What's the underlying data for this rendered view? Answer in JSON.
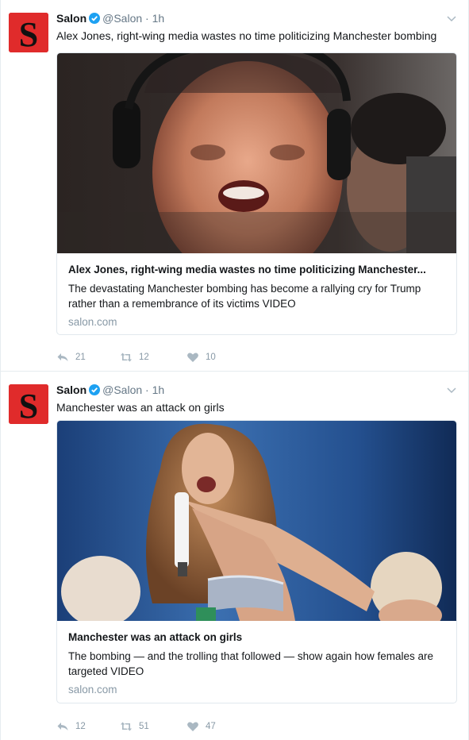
{
  "tweets": [
    {
      "author_name": "Salon",
      "handle": "@Salon",
      "separator": "·",
      "time": "1h",
      "text": "Alex Jones, right-wing media wastes no time politicizing Manchester bombing",
      "card": {
        "title": "Alex Jones, right-wing media wastes no time politicizing Manchester...",
        "description": "The devastating Manchester bombing has become a rallying cry for Trump rather than a remembrance of its victims VIDEO",
        "domain": "salon.com"
      },
      "replies": "21",
      "retweets": "12",
      "likes": "10"
    },
    {
      "author_name": "Salon",
      "handle": "@Salon",
      "separator": "·",
      "time": "1h",
      "text": "Manchester was an attack on girls",
      "card": {
        "title": "Manchester was an attack on girls",
        "description": "The bombing — and the trolling that followed — show again how females are targeted VIDEO",
        "domain": "salon.com"
      },
      "replies": "12",
      "retweets": "51",
      "likes": "47"
    }
  ],
  "colors": {
    "brand_red": "#e02b2b",
    "verified_blue": "#1da1f2",
    "muted": "#8899a6"
  },
  "icons": {
    "avatar": "salon-logo-icon",
    "verified": "verified-badge-icon",
    "caret": "chevron-down-icon",
    "reply": "reply-icon",
    "retweet": "retweet-icon",
    "like": "heart-icon"
  }
}
